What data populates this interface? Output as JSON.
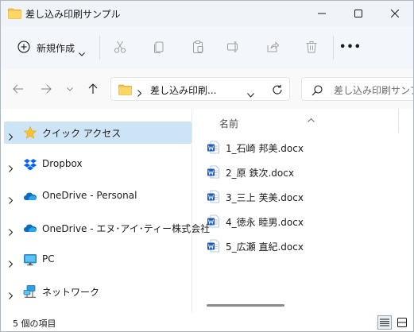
{
  "window": {
    "title": "差し込み印刷サンプル"
  },
  "toolbar": {
    "new_label": "新規作成",
    "more_label": "•••"
  },
  "address": {
    "path_text": "差し込み印刷...",
    "search_placeholder": "差し込み印刷サンプ..."
  },
  "sidebar": {
    "items": [
      {
        "label": "クイック アクセス",
        "icon": "star-icon",
        "selected": true
      },
      {
        "label": "Dropbox",
        "icon": "dropbox-icon"
      },
      {
        "label": "OneDrive - Personal",
        "icon": "cloud-icon"
      },
      {
        "label": "OneDrive - エヌ･アイ･ティー株式会社",
        "icon": "cloud-icon"
      },
      {
        "label": "PC",
        "icon": "monitor-icon"
      },
      {
        "label": "ネットワーク",
        "icon": "network-icon"
      }
    ]
  },
  "content": {
    "column_header": "名前",
    "files": [
      {
        "name": "1_石崎 邦美.docx",
        "icon": "word-doc-icon"
      },
      {
        "name": "2_原 鉄次.docx",
        "icon": "word-doc-icon"
      },
      {
        "name": "3_三上 芙美.docx",
        "icon": "word-doc-icon"
      },
      {
        "name": "4_徳永 睦男.docx",
        "icon": "word-doc-icon"
      },
      {
        "name": "5_広瀬 直紀.docx",
        "icon": "word-doc-icon"
      }
    ]
  },
  "status": {
    "item_count": "5 個の項目"
  },
  "colors": {
    "accent": "#0067c0",
    "selection": "#cde4f7",
    "folder": "#f8c44f",
    "word_blue": "#185abd"
  }
}
